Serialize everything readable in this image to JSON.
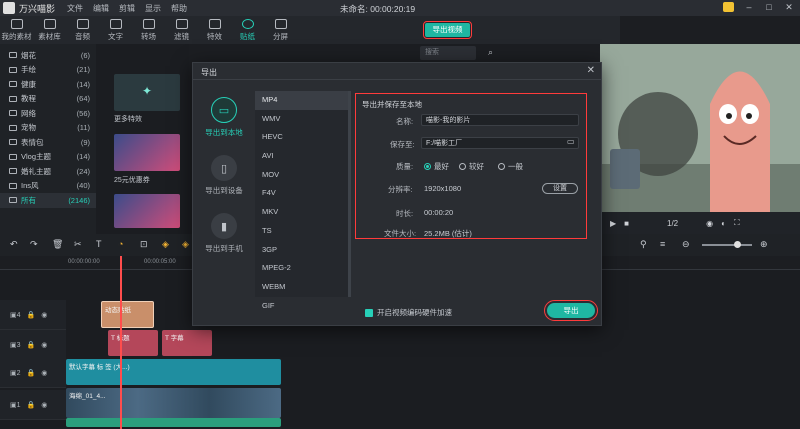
{
  "titlebar": {
    "app_name": "万兴喵影",
    "menus": [
      "文件",
      "编辑",
      "剪辑",
      "显示",
      "帮助"
    ],
    "project_title": "未命名: 00:00:20:19"
  },
  "toolbar": {
    "tools": [
      "我的素材",
      "素材库",
      "音频",
      "文字",
      "转场",
      "滤镜",
      "特效",
      "贴纸",
      "分屏"
    ],
    "active": "贴纸",
    "export_label": "导出视频"
  },
  "sidebar": {
    "items": [
      {
        "label": "烟花",
        "count": "(6)"
      },
      {
        "label": "手绘",
        "count": "(21)"
      },
      {
        "label": "健康",
        "count": "(14)"
      },
      {
        "label": "教程",
        "count": "(64)"
      },
      {
        "label": "网络",
        "count": "(56)"
      },
      {
        "label": "宠物",
        "count": "(11)"
      },
      {
        "label": "表情包",
        "count": "(9)"
      },
      {
        "label": "Vlog主题",
        "count": "(14)"
      },
      {
        "label": "婚礼主题",
        "count": "(24)"
      },
      {
        "label": "Ins风",
        "count": "(40)"
      },
      {
        "label": "所有",
        "count": "(2146)"
      }
    ]
  },
  "assets": {
    "items": [
      "更多特效",
      "25元优惠券"
    ]
  },
  "search": {
    "placeholder": "搜索"
  },
  "preview": {
    "page": "1/2"
  },
  "dialog": {
    "title": "导出",
    "side_options": [
      "导出到本地",
      "导出到设备",
      "导出到手机"
    ],
    "formats": [
      "MP4",
      "WMV",
      "HEVC",
      "AVI",
      "MOV",
      "F4V",
      "MKV",
      "TS",
      "3GP",
      "MPEG-2",
      "WEBM",
      "GIF"
    ],
    "active_format": "MP4",
    "settings": {
      "header": "导出并保存至本地",
      "name_label": "名称:",
      "name_value": "喵影-我的影片",
      "path_label": "保存至:",
      "path_value": "F:/喵影工厂",
      "quality_label": "质量:",
      "quality_options": [
        "最好",
        "较好",
        "一般"
      ],
      "resolution_label": "分辨率:",
      "resolution_value": "1920x1080",
      "settings_button": "设置",
      "duration_label": "时长:",
      "duration_value": "00:00:20",
      "size_label": "文件大小:",
      "size_value": "25.2MB (估计)"
    },
    "hw_accel_label": "开启视频编码硬件加速",
    "export_button": "导出"
  },
  "timeline": {
    "ruler_start": "00:00:00:00",
    "ruler_mark": "00:00:05:00",
    "clips": {
      "sticker": "动态贴纸",
      "text1": "T 标题",
      "text2": "T 字幕",
      "default_text": "默认字幕 标 签 (大...)",
      "video": "海绵_01_4..."
    }
  },
  "colors": {
    "accent": "#1fb7a2",
    "highlight": "#ff3b3b"
  }
}
